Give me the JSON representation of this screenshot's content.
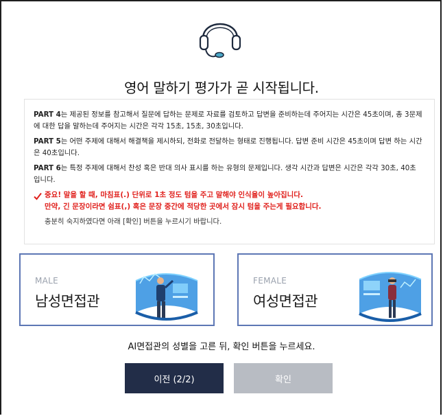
{
  "title": "영어 말하기 평가가 곧 시작됩니다.",
  "notice": {
    "parts": [
      {
        "label": "PART 4",
        "text": "는 제공된 정보를 참고해서 질문에 답하는 문제로 자료를 검토하고 답변을 준비하는데 주어지는 시간은 45초이며, 총 3문제에 대한 답을 말하는데 주어지는 시간은 각각 15초, 15초, 30초입니다."
      },
      {
        "label": "PART 5",
        "text": "는 어떤 주제에 대해서 해결책을 제시하되, 전화로 전달하는 형태로 진행됩니다. 답변 준비 시간은 45초이며 답변 하는 시간은 40초입니다."
      },
      {
        "label": "PART 6",
        "text": "는 특정 주제에 대해서 찬성 혹은 반대 의사 표시를 하는 유형의 문제입니다. 생각 시간과 답변은 시간은 각각 30초, 40초 입니다."
      }
    ],
    "warning_line1": "중요! 말을 할 때, 마침표(.) 단위로 1초 정도 텀을 주고 말해야 인식율이 높아집니다.",
    "warning_line2": "만약, 긴 문장이라면 쉼표(,) 혹은 문장 중간에 적당한 곳에서 잠시 텀을 주는게 필요합니다.",
    "confirm_note": "충분히 숙지하였다면 아래 [확인] 버튼을 누르시기 바랍니다."
  },
  "interviewers": {
    "male": {
      "en": "MALE",
      "ko": "남성면접관"
    },
    "female": {
      "en": "FEMALE",
      "ko": "여성면접관"
    }
  },
  "instruction": "AI면접관의 성별을 고른 뒤, 확인 버튼을 누르세요.",
  "buttons": {
    "prev": "이전 (2/2)",
    "confirm": "확인"
  },
  "colors": {
    "accent_border": "#5c76b4",
    "warning": "#e0201c",
    "prev_bg": "#222d48",
    "confirm_bg": "#b8bcc3"
  },
  "icons": {
    "header": "headset-icon",
    "warning": "check-icon"
  }
}
